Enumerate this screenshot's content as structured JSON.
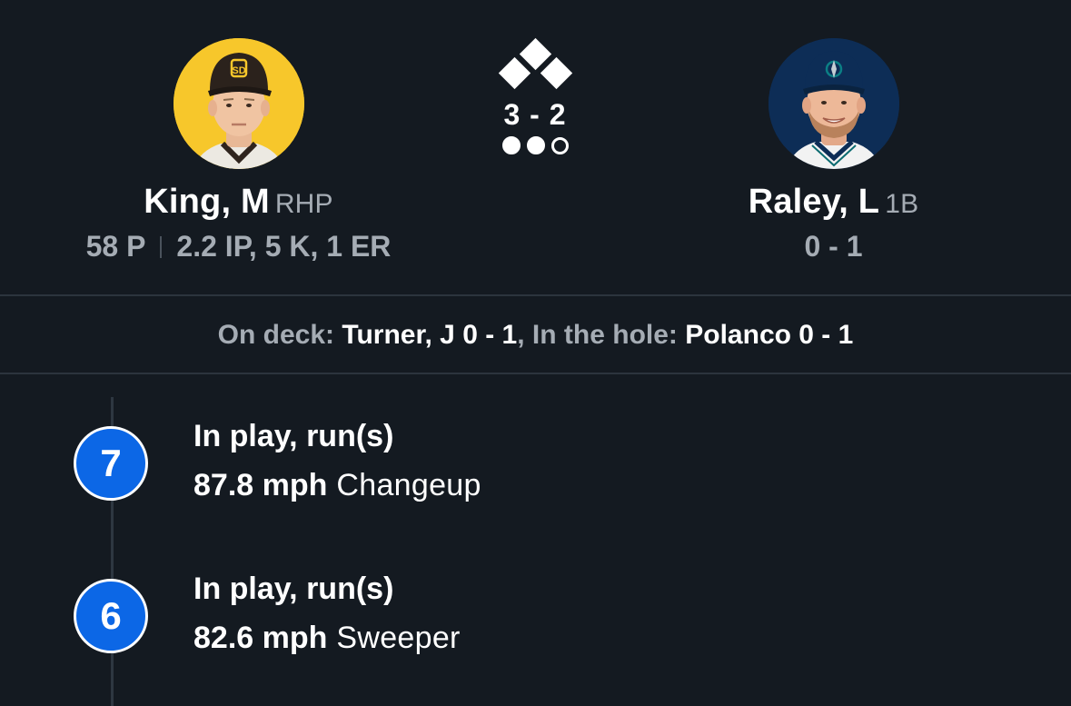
{
  "pitcher": {
    "name": "King, M",
    "position": "RHP",
    "pitch_count": "58 P",
    "line": "2.2 IP, 5 K, 1 ER",
    "avatar_bg": "#f7c72b",
    "team_icon": "padres-logo-icon"
  },
  "batter": {
    "name": "Raley, L",
    "position": "1B",
    "line": "0 - 1",
    "avatar_bg": "#0d2d56",
    "team_icon": "mariners-logo-icon"
  },
  "situation": {
    "count": "3 - 2",
    "bases_occupied": {
      "first": true,
      "second": true,
      "third": true
    },
    "outs": 2,
    "outs_max": 3
  },
  "due_up": {
    "on_deck_label": "On deck:",
    "on_deck_player": "Turner, J 0 - 1",
    "separator": ",",
    "in_hole_label": "In the hole:",
    "in_hole_player": "Polanco 0 - 1"
  },
  "pitches": [
    {
      "number": "7",
      "result": "In play, run(s)",
      "speed": "87.8 mph",
      "type": "Changeup"
    },
    {
      "number": "6",
      "result": "In play, run(s)",
      "speed": "82.6 mph",
      "type": "Sweeper"
    }
  ],
  "colors": {
    "background": "#141a21",
    "pitch_badge": "#0c67e6",
    "muted_text": "#a5acb4"
  }
}
